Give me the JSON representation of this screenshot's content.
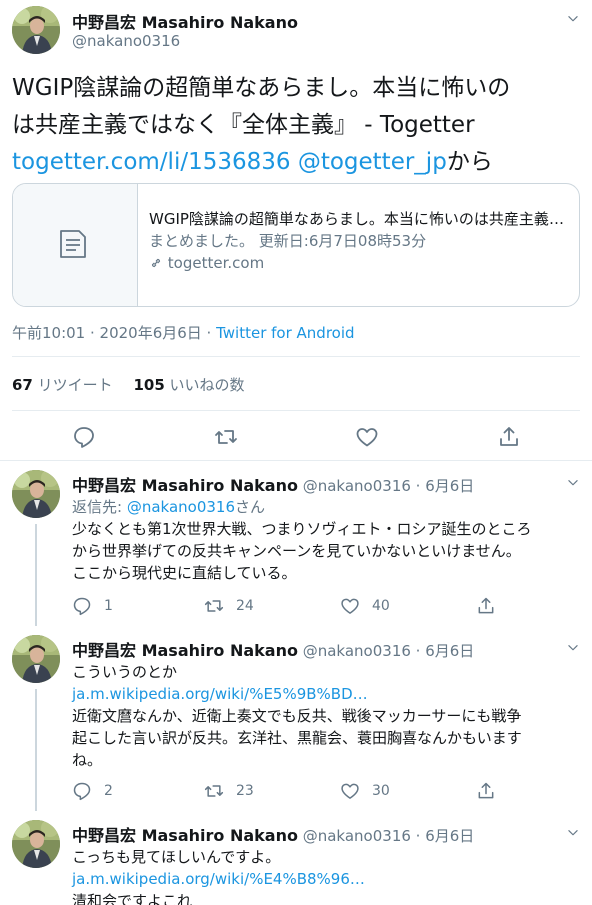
{
  "main": {
    "name": "中野昌宏 Masahiro Nakano",
    "handle": "@nakano0316",
    "text_line1": "WGIP陰謀論の超簡単なあらまし。本当に怖いの",
    "text_line2": "は共産主義ではなく『全体主義』 - Togetter",
    "link1": "togetter.com/li/1536836",
    "mention": "@togetter_jp",
    "text_tail": "から",
    "card": {
      "title": "WGIP陰謀論の超簡単なあらまし。本当に怖いのは共産主義ではなく『全体主義』",
      "desc": "まとめました。 更新日:6月7日08時53分",
      "domain": "togetter.com"
    },
    "time": "午前10:01 · 2020年6月6日 · ",
    "source": "Twitter for Android",
    "retweets_count": "67",
    "retweets_label": "リツイート",
    "likes_count": "105",
    "likes_label": "いいねの数"
  },
  "replies": [
    {
      "name": "中野昌宏 Masahiro Nakano",
      "handle_date": "@nakano0316 · 6月6日",
      "reply_to_label": "返信先: ",
      "reply_to_handle": "@nakano0316",
      "reply_to_suffix": "さん",
      "line1": "少なくとも第1次世界大戦、つまりソヴィエト・ロシア誕生のところ",
      "line2": "から世界挙げての反共キャンペーンを見ていかないといけません。",
      "line3": "ここから現代史に直結している。",
      "replies": "1",
      "retweets": "24",
      "likes": "40"
    },
    {
      "name": "中野昌宏 Masahiro Nakano",
      "handle_date": "@nakano0316 · 6月6日",
      "line1": "こういうのとか",
      "link": "ja.m.wikipedia.org/wiki/%E5%9B%BD…",
      "line2": "近衛文麿なんか、近衛上奏文でも反共、戦後マッカーサーにも戦争",
      "line3": "起こした言い訳が反共。玄洋社、黒龍会、蓑田胸喜なんかもいます",
      "line4": "ね。",
      "replies": "2",
      "retweets": "23",
      "likes": "30"
    },
    {
      "name": "中野昌宏 Masahiro Nakano",
      "handle_date": "@nakano0316 · 6月6日",
      "line1": "こっちも見てほしいんですよ。",
      "link": "ja.m.wikipedia.org/wiki/%E4%B8%96…",
      "line2": "清和会ですよこれ"
    }
  ]
}
